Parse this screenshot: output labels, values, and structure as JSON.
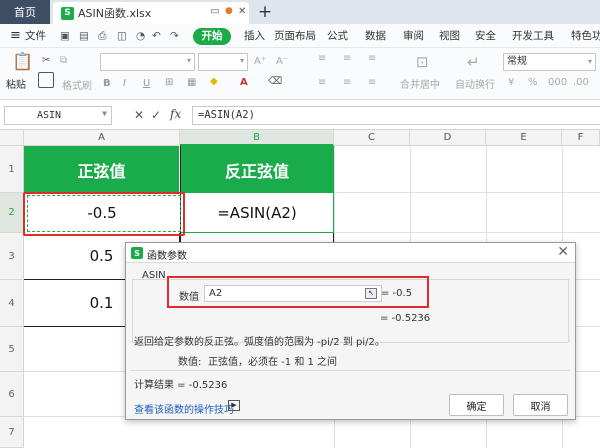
{
  "tabs": {
    "home": "首页",
    "file": "ASIN函数.xlsx",
    "add": "+"
  },
  "menu": {
    "hamburger": "≡",
    "file": "文件",
    "items": [
      "开始",
      "插入",
      "页面布局",
      "公式",
      "数据",
      "审阅",
      "视图",
      "安全",
      "开发工具",
      "特色功能"
    ]
  },
  "ribbon": {
    "paste": "粘贴",
    "format_painter": "格式刷",
    "number_format": "常规",
    "merge_center": "合并居中",
    "auto_wrap": "自动换行",
    "font_buttons": [
      "B",
      "I",
      "U",
      "A"
    ]
  },
  "formula_bar": {
    "name_box": "ASIN",
    "cancel": "✕",
    "enter": "✓",
    "fx": "fx",
    "formula": "=ASIN(A2)"
  },
  "grid": {
    "columns": [
      "A",
      "B",
      "C",
      "D",
      "E",
      "F"
    ],
    "rows": [
      "1",
      "2",
      "3",
      "4",
      "5",
      "6",
      "7"
    ],
    "cells": {
      "A1": "正弦值",
      "B1": "反正弦值",
      "A2": "-0.5",
      "B2": "=ASIN(A2)",
      "A3": "0.5",
      "A4": "0.1"
    }
  },
  "dialog": {
    "title": "函数参数",
    "function_name": "ASIN",
    "arg_label": "数值",
    "arg_value": "A2",
    "arg_result": "= -0.5",
    "formula_result_inline": "= -0.5236",
    "description": "返回给定参数的反正弦。弧度值的范围为 -pi/2 到 pi/2。",
    "arg_desc_label": "数值:",
    "arg_desc": "正弦值，必须在 -1 和 1 之间",
    "calc_result": "计算结果 =  -0.5236",
    "help_link": "查看该函数的操作技巧",
    "ok": "确定",
    "cancel": "取消",
    "colors": {
      "accent": "#1aab4a",
      "highlight": "#e12c2c",
      "link": "#1b5fc1"
    }
  }
}
